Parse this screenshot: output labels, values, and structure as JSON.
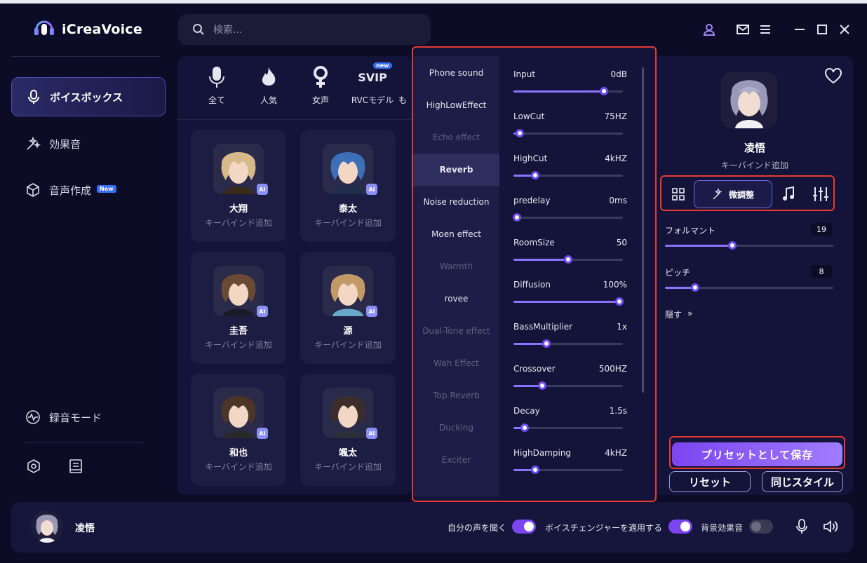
{
  "app": {
    "name": "iCreaVoice"
  },
  "search": {
    "placeholder": "検索..."
  },
  "sidebar": {
    "items": [
      {
        "label": "ボイスボックス",
        "active": true
      },
      {
        "label": "効果音"
      },
      {
        "label": "音声作成",
        "badge": "New"
      }
    ],
    "record_mode": "録音モード"
  },
  "categories": [
    {
      "label": "全て",
      "icon": "mic-icon"
    },
    {
      "label": "人気",
      "icon": "flame-icon"
    },
    {
      "label": "女声",
      "icon": "female-icon"
    },
    {
      "label": "RVCモデル",
      "icon": "svip-icon",
      "icon_text": "SVIP",
      "badge": "new"
    },
    {
      "label": "も"
    }
  ],
  "voices": [
    {
      "name": "大翔",
      "sub": "キーバインド追加",
      "ai": "AI"
    },
    {
      "name": "泰太",
      "sub": "キーバインド追加",
      "ai": "AI"
    },
    {
      "name": "圭吾",
      "sub": "キーバインド追加",
      "ai": "AI"
    },
    {
      "name": "源",
      "sub": "キーバインド追加",
      "ai": "AI"
    },
    {
      "name": "和也",
      "sub": "キーバインド追加",
      "ai": "AI"
    },
    {
      "name": "颯太",
      "sub": "キーバインド追加",
      "ai": "AI"
    }
  ],
  "effects": [
    {
      "label": "Phone sound",
      "state": "normal"
    },
    {
      "label": "HighLowEffect",
      "state": "normal"
    },
    {
      "label": "Echo effect",
      "state": "dim"
    },
    {
      "label": "Reverb",
      "state": "selected"
    },
    {
      "label": "Noise reduction",
      "state": "normal"
    },
    {
      "label": "Moen effect",
      "state": "normal"
    },
    {
      "label": "Warmth",
      "state": "dim"
    },
    {
      "label": "rovee",
      "state": "normal"
    },
    {
      "label": "Dual-Tone effect",
      "state": "dim"
    },
    {
      "label": "Wah Effect",
      "state": "dim"
    },
    {
      "label": "Top Reverb",
      "state": "dim"
    },
    {
      "label": "Ducking",
      "state": "dim"
    },
    {
      "label": "Exciter",
      "state": "dim"
    }
  ],
  "params": [
    {
      "name": "Input",
      "value": "0dB",
      "level": 0.83
    },
    {
      "name": "LowCut",
      "value": "75HZ",
      "level": 0.06
    },
    {
      "name": "HighCut",
      "value": "4kHZ",
      "level": 0.2
    },
    {
      "name": "predelay",
      "value": "0ms",
      "level": 0.03
    },
    {
      "name": "RoomSize",
      "value": "50",
      "level": 0.5
    },
    {
      "name": "Diffusion",
      "value": "100%",
      "level": 0.97
    },
    {
      "name": "BassMultiplier",
      "value": "1x",
      "level": 0.3
    },
    {
      "name": "Crossover",
      "value": "500HZ",
      "level": 0.26
    },
    {
      "name": "Decay",
      "value": "1.5s",
      "level": 0.1
    },
    {
      "name": "HighDamping",
      "value": "4kHZ",
      "level": 0.2
    }
  ],
  "right": {
    "name": "凌悟",
    "sub": "キーバインド追加",
    "finetune_label": "微調整",
    "formant_label": "フォルマント",
    "formant_value": "19",
    "formant_level": 0.4,
    "pitch_label": "ピッチ",
    "pitch_value": "8",
    "pitch_level": 0.18,
    "hide_label": "隠す",
    "hide_arrow": "»",
    "save_label": "プリセットとして保存",
    "reset_label": "リセット",
    "same_style_label": "同じスタイル"
  },
  "bottom": {
    "name": "凌悟",
    "listen_label": "自分の声を聞く",
    "apply_label": "ボイスチェンジャーを適用する",
    "bgm_label": "背景効果音"
  },
  "colors": {
    "accent": "#7b45f0",
    "highlight_border": "#e8392f",
    "bg": "#0c0c26",
    "panel": "#14143a"
  }
}
